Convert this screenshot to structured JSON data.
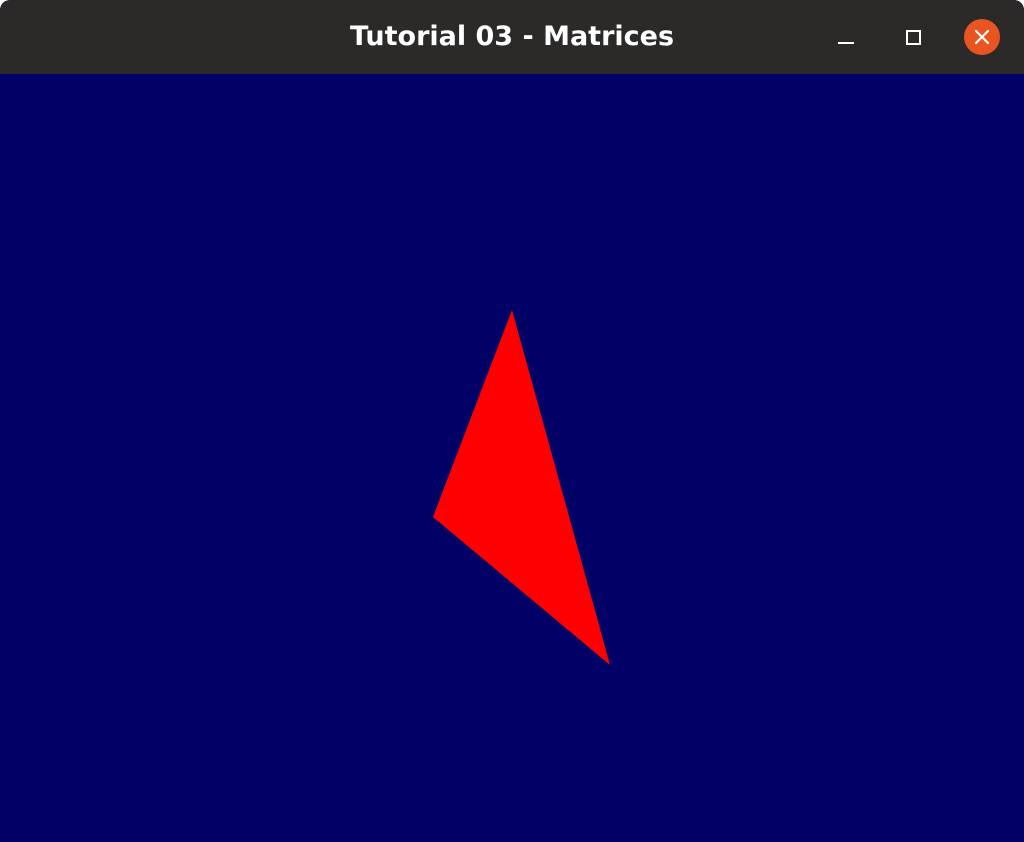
{
  "window": {
    "title": "Tutorial 03 - Matrices",
    "controls": {
      "minimize_icon": "minimize-icon",
      "maximize_icon": "maximize-icon",
      "close_icon": "close-icon"
    }
  },
  "scene": {
    "background_color": "#000066",
    "triangle_color": "#ff0000",
    "shape": "triangle"
  },
  "colors": {
    "titlebar": "#2c2a29",
    "close_button": "#e95420",
    "title_text": "#ffffff"
  }
}
